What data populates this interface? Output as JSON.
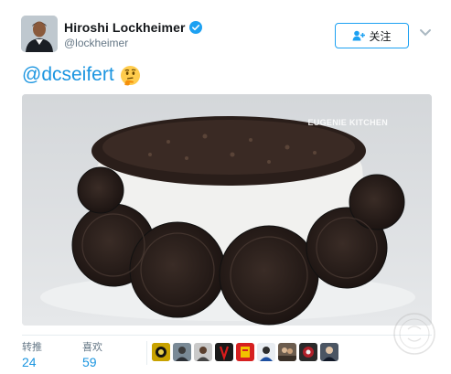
{
  "author": {
    "display_name": "Hiroshi Lockheimer",
    "handle": "@lockheimer",
    "verified": true,
    "verified_color": "#1da1f2"
  },
  "follow_button": {
    "label": "关注",
    "icon": "add-user-icon"
  },
  "menu": {
    "icon": "chevron-down-icon"
  },
  "tweet": {
    "text": "@dcseifert",
    "emoji": "thinking-face-emoji",
    "link_color": "#1b95e0"
  },
  "media": {
    "description_icon": "oreo-cake-photo",
    "watermark": "EUGENIE KITCHEN"
  },
  "stats": {
    "retweets_label": "转推",
    "retweets_count": "24",
    "likes_label": "喜欢",
    "likes_count": "59"
  },
  "likers": [
    "liker-avatar-1",
    "liker-avatar-2",
    "liker-avatar-3",
    "liker-avatar-4",
    "liker-avatar-5",
    "liker-avatar-6",
    "liker-avatar-7",
    "liker-avatar-8",
    "liker-avatar-9"
  ]
}
